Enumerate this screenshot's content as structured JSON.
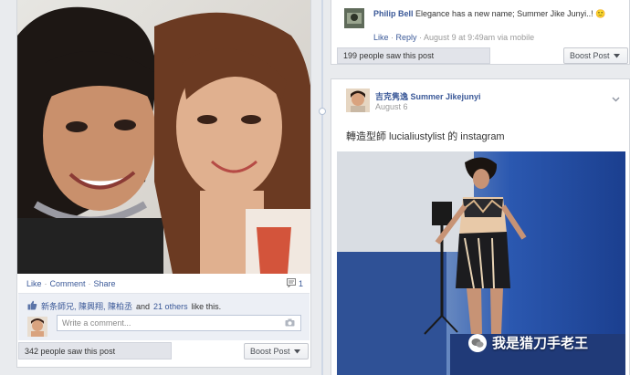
{
  "left_post": {
    "actions": {
      "like": "Like",
      "comment": "Comment",
      "share": "Share"
    },
    "comment_count": "1",
    "likes": {
      "names": "新条師兄, 陳興翔, 陳柏丞",
      "connector": "and",
      "others": "21 others",
      "suffix": "like this."
    },
    "comment_placeholder": "Write a comment...",
    "seen": "342 people saw this post",
    "boost": "Boost Post"
  },
  "right_top": {
    "comment": {
      "author": "Philip Bell",
      "text": "Elegance has a new name; Summer Jike Junyi..! 🙂",
      "like": "Like",
      "reply": "Reply",
      "meta": "August 9 at 9:49am via mobile"
    },
    "seen": "199 people saw this post",
    "boost": "Boost Post"
  },
  "right_post": {
    "author": "吉克隽逸 Summer Jikejunyi",
    "date": "August 6",
    "body": "轉造型師 lucialiustylist 的 instagram"
  },
  "watermark": "我是猎刀手老王",
  "icons": {
    "thumb": "thumbs-up-icon",
    "comment": "comment-bubble-icon",
    "camera": "camera-icon",
    "caret": "caret-down-icon",
    "chevron": "chevron-down-icon"
  },
  "colors": {
    "link": "#3b5998",
    "background": "#e9ebee"
  }
}
